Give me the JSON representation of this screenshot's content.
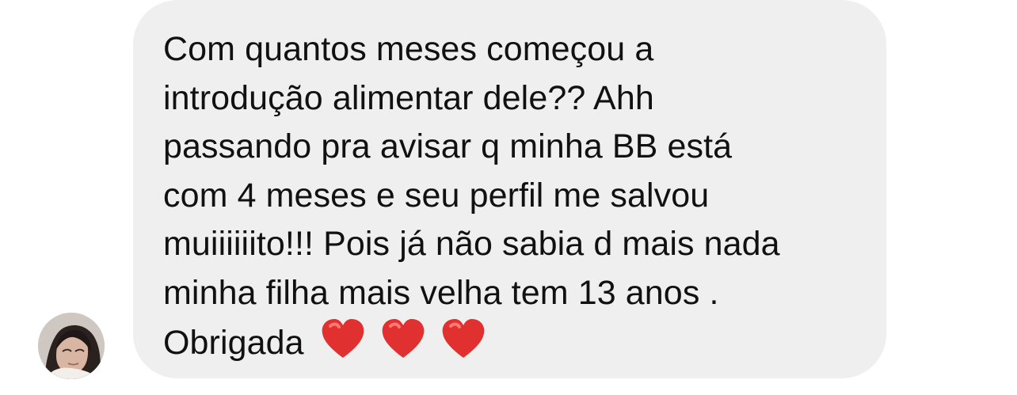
{
  "message": {
    "lines": [
      "Com quantos meses começou a",
      "introdução alimentar dele??   Ahh",
      "passando pra avisar q minha BB está",
      "com 4 meses e seu perfil me salvou",
      "muiiiiiito!!! Pois já não sabia d mais nada",
      "minha filha mais velha tem 13 anos .",
      "Obrigada"
    ],
    "hearts": [
      "heart-icon",
      "heart-icon",
      "heart-icon"
    ],
    "heart_color": "#e0302f",
    "bubble_color": "#efefef",
    "text_color": "#111111"
  },
  "avatar": {
    "icon": "avatar-photo"
  }
}
